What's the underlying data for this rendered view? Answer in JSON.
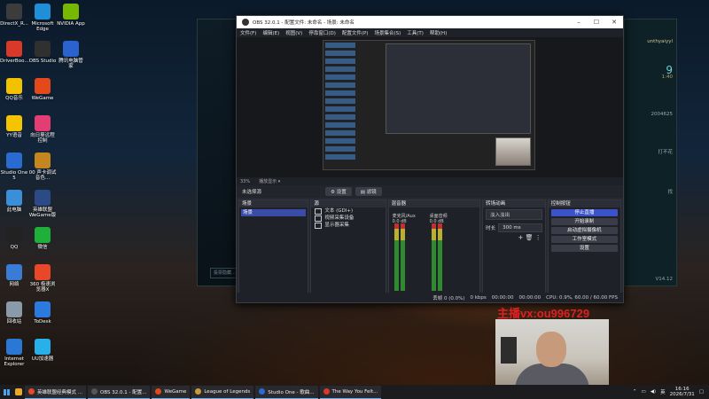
{
  "desktop": {
    "icons": [
      {
        "label": "DirectX_R...",
        "color": "#3c3c3c"
      },
      {
        "label": "Microsoft Edge",
        "color": "#1f8fd8"
      },
      {
        "label": "NVIDIA App",
        "color": "#76b900"
      },
      {
        "label": "DriverBoo...",
        "color": "#d83a2a"
      },
      {
        "label": "OBS Studio",
        "color": "#303030"
      },
      {
        "label": "腾讯电脑管家",
        "color": "#2a62d0"
      },
      {
        "label": "QQ音乐",
        "color": "#f2c200"
      },
      {
        "label": "WeGame",
        "color": "#e24a1b"
      },
      {
        "label": "YY语音",
        "color": "#f5c400"
      },
      {
        "label": "向日葵远程控制",
        "color": "#e33d73"
      },
      {
        "label": "Studio One 5",
        "color": "#2a6bd2"
      },
      {
        "label": "00 声卡调试音色...",
        "color": "#c4861f"
      },
      {
        "label": "此电脑",
        "color": "#3a8fd8"
      },
      {
        "label": "英雄联盟WeGame版",
        "color": "#2b4a86"
      },
      {
        "label": "QQ",
        "color": "#222222"
      },
      {
        "label": "微信",
        "color": "#1fb03a"
      },
      {
        "label": "网络",
        "color": "#3a7bd6"
      },
      {
        "label": "360 极速浏览器X",
        "color": "#e8472a"
      },
      {
        "label": "回收站",
        "color": "#8a9aa8"
      },
      {
        "label": "ToDesk",
        "color": "#2c7ae0"
      },
      {
        "label": "Internet Explorer",
        "color": "#2a78d4"
      },
      {
        "label": "UU加速器",
        "color": "#2ab0e8"
      }
    ]
  },
  "lol": {
    "user": "unthyaiyyl",
    "texts": [
      "9",
      "2004625",
      "打不花",
      "找",
      "1:40"
    ],
    "chat_placeholder": "投票隐藏...",
    "version": "V14.12"
  },
  "obs": {
    "title": "OBS 32.0.1 - 配置文件: 未命名 - 场景: 未命名",
    "menu": [
      "文件(F)",
      "编辑(E)",
      "视图(V)",
      "停靠窗口(D)",
      "配置文件(P)",
      "场景集合(S)",
      "工具(T)",
      "帮助(H)"
    ],
    "zoom": "33%",
    "zoom_hint": "播放显示 ▾",
    "current_scene": "未选择源",
    "props_btn": "设置",
    "filters_btn": "滤镜",
    "docks": {
      "scenes": {
        "title": "场景",
        "items": [
          "场景"
        ]
      },
      "sources": {
        "title": "源",
        "items": [
          "文本 (GDI+)",
          "视频采集设备",
          "显示器采集"
        ]
      },
      "mixer": {
        "title": "混音器",
        "channels": [
          {
            "name": "麦克风/Aux",
            "db": "0.0 dB"
          },
          {
            "name": "桌面音频",
            "db": "0.0 dB"
          }
        ],
        "scale": [
          "0",
          "-5",
          "-10",
          "-15",
          "-20",
          "-25",
          "-30",
          "-35",
          "-40",
          "-45",
          "-50",
          "-55",
          "-60"
        ]
      },
      "transitions": {
        "title": "转场动画",
        "selected": "淡入淡出",
        "duration_label": "时长",
        "duration": "300 ms"
      },
      "controls": {
        "title": "控制按钮",
        "buttons": [
          "停止直播",
          "开始录制",
          "启动虚拟摄像机",
          "工作室模式",
          "设置"
        ]
      }
    },
    "status": {
      "dropped": "丢帧 0 (0.0%)",
      "bitrate": "0 kbps",
      "live_time": "00:00:00",
      "rec_time": "00:00:00",
      "cpu": "CPU: 0.9%, 60.00 / 60.00 FPS"
    }
  },
  "overlay": {
    "watermark": "主播vx:ou996729"
  },
  "taskbar": {
    "apps": [
      {
        "label": "英雄联盟经典模式 ...",
        "color": "#e8472a"
      },
      {
        "label": "OBS 32.0.1 - 配置...",
        "color": "#555555"
      },
      {
        "label": "WeGame",
        "color": "#e24a1b"
      },
      {
        "label": "League of Legends",
        "color": "#c89b3c"
      },
      {
        "label": "Studio One - 歌曲...",
        "color": "#2a6bd2"
      },
      {
        "label": "The Way You Felt...",
        "color": "#d83a2a"
      }
    ],
    "lang": "英",
    "time": "16:16",
    "date": "2026/7/31"
  }
}
